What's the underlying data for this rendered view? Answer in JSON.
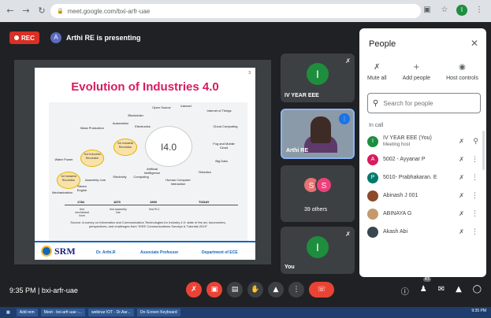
{
  "browser": {
    "url": "meet.google.com/bxi-arfr-uae",
    "profile_initial": "I"
  },
  "meet": {
    "rec_label": "REC",
    "presenter_initial": "A",
    "presenting_text": "Arthi RE is presenting",
    "meeting_code": "bxi-arfr-uae",
    "time": "9:35 PM",
    "time_code_line": "9:35 PM | bxi-arfr-uae"
  },
  "slide": {
    "title": "Evolution of Industries 4.0",
    "page_num": "3",
    "center_label": "I4.0",
    "nodes": {
      "open_source": "Open Source",
      "internet": "Internet",
      "iot": "Internet of Things",
      "blockchain": "Blockchain",
      "cloud": "Cloud Computing",
      "mass_production": "Mass Production",
      "automation": "Automation",
      "electronics": "Electronics",
      "fog": "Fog and Mobile Cloud",
      "water": "Water Power",
      "big_data": "Big Data",
      "ai": "Artificial Intelligence",
      "hci": "Human Computer Interaction",
      "robotics": "Robotics",
      "assembly": "Assembly Line",
      "electricity": "Electricity",
      "computing": "Computing",
      "mechanization": "Mechanization",
      "steam": "Steam Engine"
    },
    "revolutions": [
      "1st Industrial Revolution",
      "2nd Industrial Revolution",
      "3rd Industrial Revolution"
    ],
    "timeline": [
      {
        "year": "1784",
        "desc": "first mechanical loom"
      },
      {
        "year": "1870",
        "desc": "first assembly line"
      },
      {
        "year": "1969",
        "desc": "first PLC"
      },
      {
        "year": "TODAY",
        "desc": ""
      }
    ],
    "source": "Source: A survey on Information and Communication Technologies for Industry 4.0: state of the art, taxonomies, perspectives, and challenges from \"IEEE Communications Surveys & Tutorials 2019\"",
    "footer": {
      "logo": "SRM",
      "name": "Dr. Arthi.R",
      "role": "Associate Professor",
      "dept": "Department of ECE"
    }
  },
  "tiles": [
    {
      "label": "IV YEAR EEE",
      "initial": "I",
      "color": "#1e8e3e"
    },
    {
      "label": "Arthi RE"
    },
    {
      "label": "39 others",
      "initials": [
        "S",
        "S"
      ]
    },
    {
      "label": "You",
      "initial": "I",
      "color": "#1e8e3e"
    }
  ],
  "panel": {
    "title": "People",
    "actions": {
      "mute_all": "Mute all",
      "add_people": "Add people",
      "host_controls": "Host controls"
    },
    "search_placeholder": "Search for people",
    "in_call": "In call",
    "people": [
      {
        "initial": "I",
        "name": "IV YEAR EEE (You)",
        "sub": "Meeting host",
        "color": "#1e8e3e"
      },
      {
        "initial": "A",
        "name": "5002 - Ayyanar P",
        "sub": "",
        "color": "#d81b60"
      },
      {
        "initial": "P",
        "name": "5010- Prabhakaran. E",
        "sub": "",
        "color": "#00796b"
      },
      {
        "initial": "",
        "name": "Abinash J 001",
        "sub": "",
        "color": "#8d4a2a"
      },
      {
        "initial": "",
        "name": "ABINAYA G",
        "sub": "",
        "color": "#c49a6c"
      },
      {
        "initial": "",
        "name": "Akash Abi",
        "sub": "",
        "color": "#37474f"
      }
    ]
  },
  "bottom": {
    "participant_count": "43"
  },
  "taskbar": {
    "tasks": [
      "Add rem",
      "Meet - bxi-arfr-uae -...",
      "webinar IOT - Dr.Aar...",
      "On-Screen Keyboard"
    ],
    "clock": "9:35 PM"
  }
}
